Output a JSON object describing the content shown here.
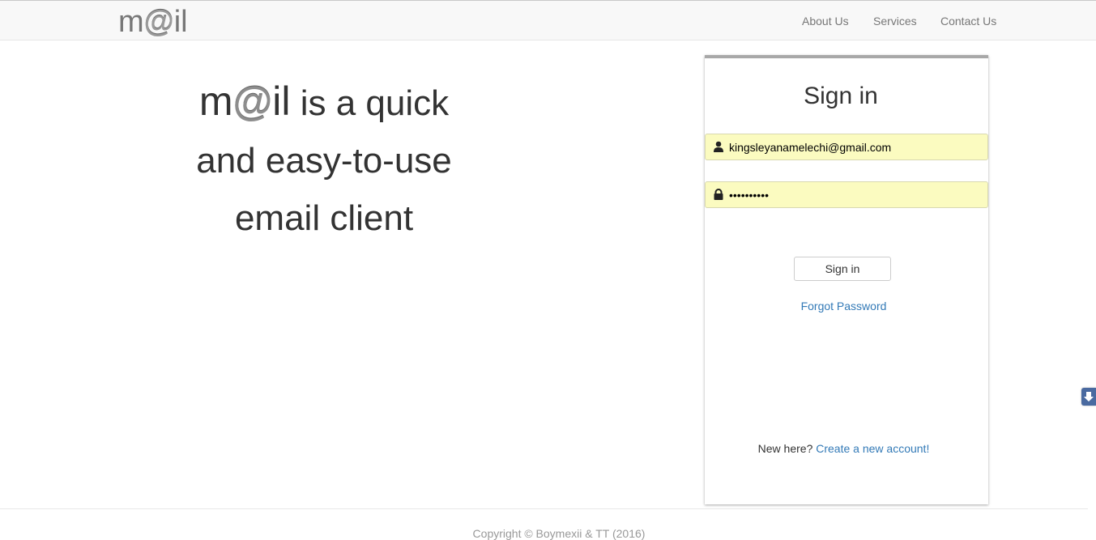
{
  "brand": {
    "pre": "m",
    "at": "@",
    "post": "il"
  },
  "nav": {
    "about": "About Us",
    "services": "Services",
    "contact": "Contact Us"
  },
  "hero": {
    "brand_pre": "m",
    "brand_at": "@",
    "brand_post": "il",
    "line1_rest": " is a quick",
    "line2": "and easy-to-use",
    "line3": "email client"
  },
  "signin": {
    "title": "Sign in",
    "email_value": "kingsleyanamelechi@gmail.com",
    "password_value": "••••••••••",
    "button_label": "Sign in",
    "forgot_label": "Forgot Password",
    "new_here_text": "New here? ",
    "create_account_label": "Create a new account!"
  },
  "icons": {
    "email": "user-icon",
    "password": "lock-icon",
    "side_tab": "arrow-down-icon"
  },
  "colors": {
    "field_bg": "#fbfbc0",
    "link": "#337ab7",
    "side_tab": "#4a6aa0"
  },
  "footer": {
    "copyright": "Copyright © Boymexii & TT (2016)"
  }
}
